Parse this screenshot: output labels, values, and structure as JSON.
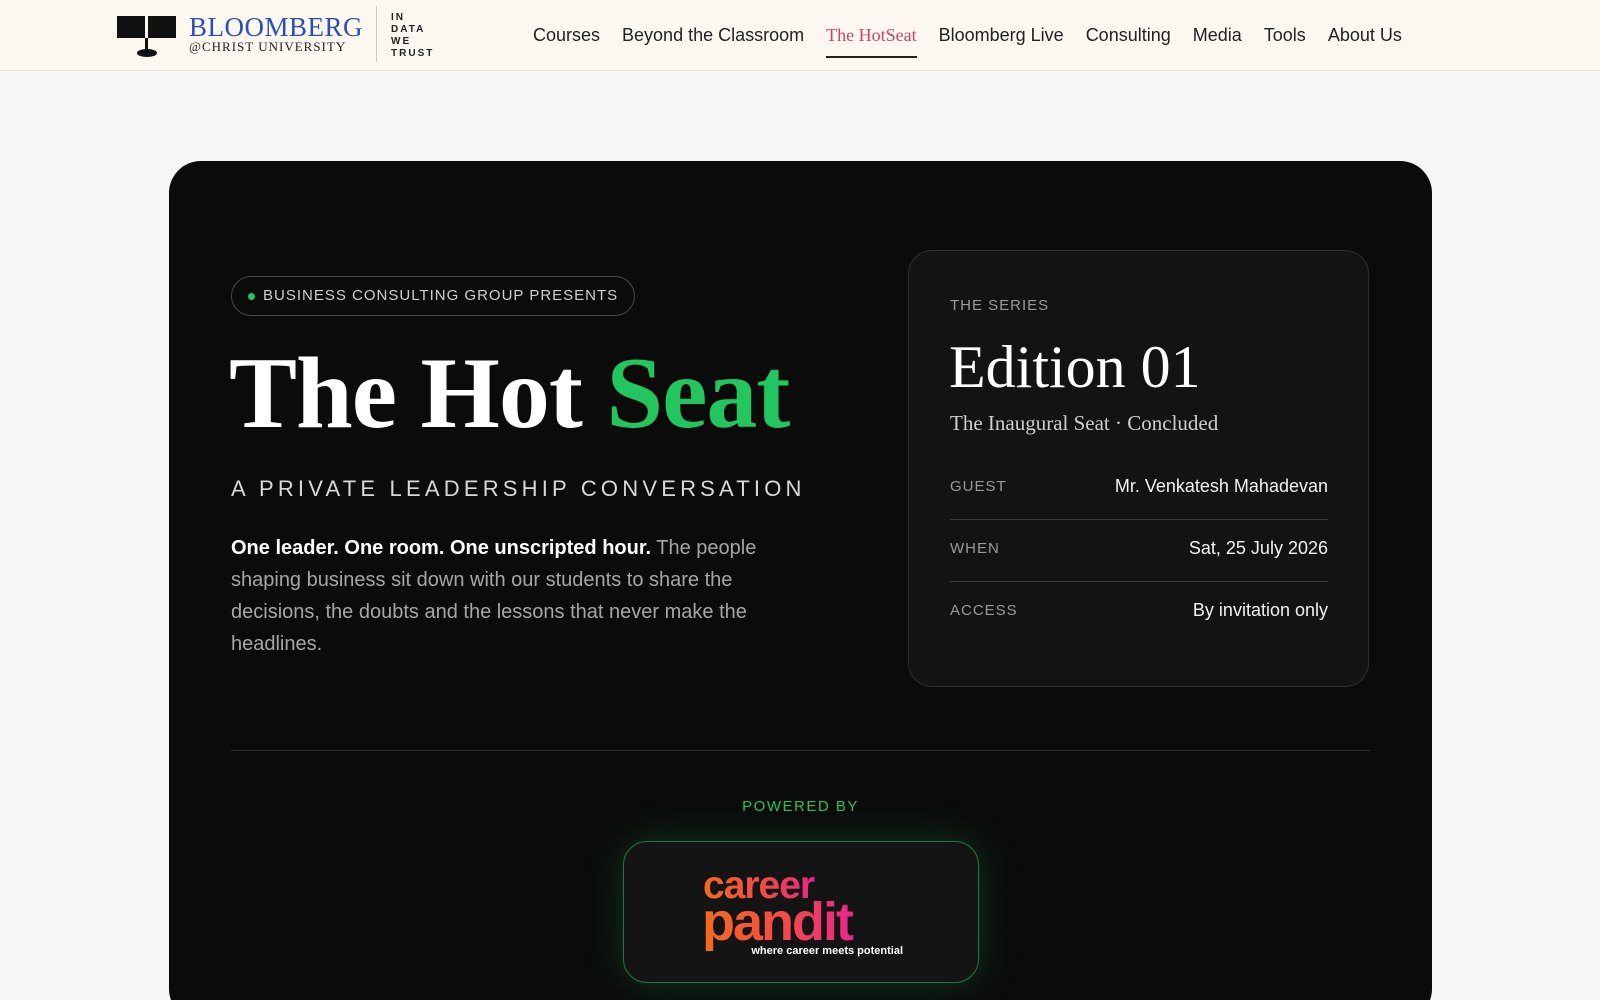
{
  "brand": {
    "title": "BLOOMBERG",
    "subtitle": "@CHRIST UNIVERSITY",
    "motto": [
      "IN",
      "DATA",
      "WE",
      "TRUST"
    ]
  },
  "nav": {
    "items": [
      {
        "label": "Courses",
        "active": false
      },
      {
        "label": "Beyond the Classroom",
        "active": false
      },
      {
        "label": "The HotSeat",
        "active": true
      },
      {
        "label": "Bloomberg Live",
        "active": false
      },
      {
        "label": "Consulting",
        "active": false
      },
      {
        "label": "Media",
        "active": false
      },
      {
        "label": "Tools",
        "active": false
      },
      {
        "label": "About Us",
        "active": false
      }
    ]
  },
  "hero": {
    "eyebrow": "BUSINESS CONSULTING GROUP PRESENTS",
    "title_main": "The Hot ",
    "title_accent": "Seat",
    "subtitle": "A PRIVATE LEADERSHIP CONVERSATION",
    "desc_bold": "One leader. One room. One unscripted hour.",
    "desc_rest": " The people shaping business sit down with our students to share the decisions, the doubts and the lessons that never make the headlines."
  },
  "series": {
    "label": "THE SERIES",
    "title": "Edition 01",
    "subtitle": "The Inaugural Seat · Concluded",
    "rows": [
      {
        "key": "GUEST",
        "value": "Mr. Venkatesh Mahadevan"
      },
      {
        "key": "WHEN",
        "value": "Sat, 25 July 2026"
      },
      {
        "key": "ACCESS",
        "value": "By invitation only"
      }
    ]
  },
  "sponsor": {
    "powered_label": "POWERED BY",
    "logo_line1": "career",
    "logo_line2": "pandit",
    "logo_tagline": "where career meets potential"
  },
  "colors": {
    "accent_green": "#22c55e",
    "nav_active": "#c9456b",
    "brand_blue": "#2c4fb4",
    "logo_orange": "#f26b1d",
    "logo_pink": "#e8268a"
  }
}
